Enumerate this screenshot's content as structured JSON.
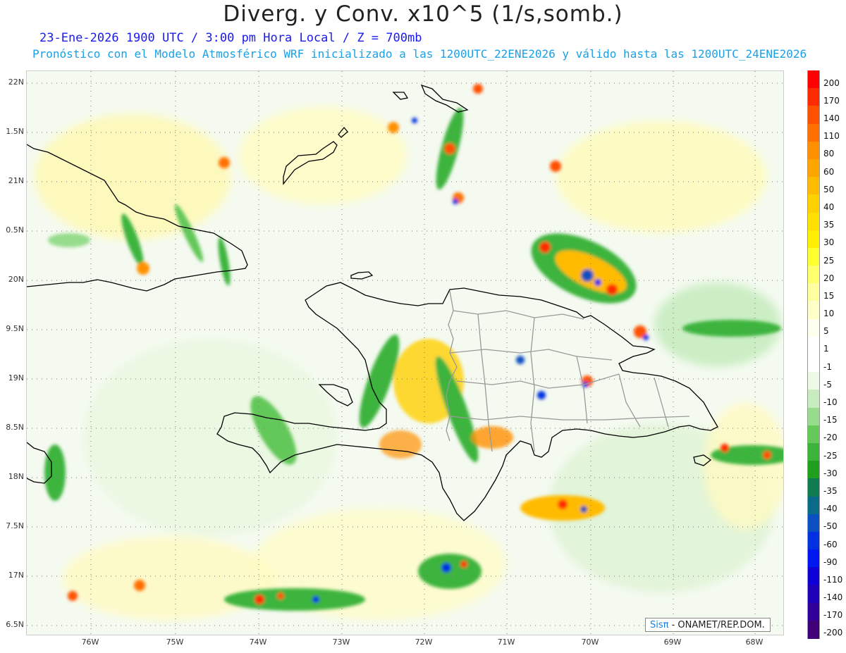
{
  "header": {
    "title": "Diverg. y Conv. x10^5 (1/s,somb.)",
    "line1": "23-Ene-2026  1900 UTC / 3:00 pm Hora Local / Z = 700mb",
    "line2": "Pronóstico con el Modelo Atmosférico WRF inicializado a las 1200UTC_22ENE2026 y válido hasta las  1200UTC_24ENE2026"
  },
  "axes": {
    "lat_labels": [
      "22N",
      "1.5N",
      "21N",
      "0.5N",
      "20N",
      "9.5N",
      "19N",
      "8.5N",
      "18N",
      "7.5N",
      "17N",
      "6.5N"
    ],
    "lon_labels": [
      "76W",
      "75W",
      "74W",
      "73W",
      "72W",
      "71W",
      "70W",
      "69W",
      "68W"
    ]
  },
  "colorbar": {
    "labels": [
      "200",
      "170",
      "140",
      "110",
      "80",
      "60",
      "50",
      "40",
      "35",
      "30",
      "25",
      "20",
      "15",
      "10",
      "5",
      "1",
      "-1",
      "-5",
      "-10",
      "-15",
      "-20",
      "-25",
      "-30",
      "-35",
      "-40",
      "-50",
      "-60",
      "-90",
      "-110",
      "-140",
      "-170",
      "-200"
    ],
    "colors": [
      "#ff0000",
      "#ff2a00",
      "#ff5000",
      "#ff7000",
      "#ff9000",
      "#ffa500",
      "#ffbb00",
      "#ffd000",
      "#ffe000",
      "#ffee00",
      "#ffff30",
      "#ffff70",
      "#ffffa0",
      "#ffffc8",
      "#fffff0",
      "#ffffff",
      "#ffffff",
      "#ecf8e8",
      "#c8ecc0",
      "#96dc8c",
      "#64c85a",
      "#3cb43c",
      "#1ea01e",
      "#107a50",
      "#0a6a8a",
      "#0a50c0",
      "#0030e0",
      "#0018f0",
      "#1000d8",
      "#2000b8",
      "#300098",
      "#400078"
    ]
  },
  "credit": {
    "brand": "Sisπ",
    "text": " - ONAMET/REP.DOM."
  },
  "colors": {
    "title": "#222222",
    "line1": "#1a1aee",
    "line2": "#1aa0e6",
    "coast": "#000000",
    "provinces": "#999999"
  }
}
